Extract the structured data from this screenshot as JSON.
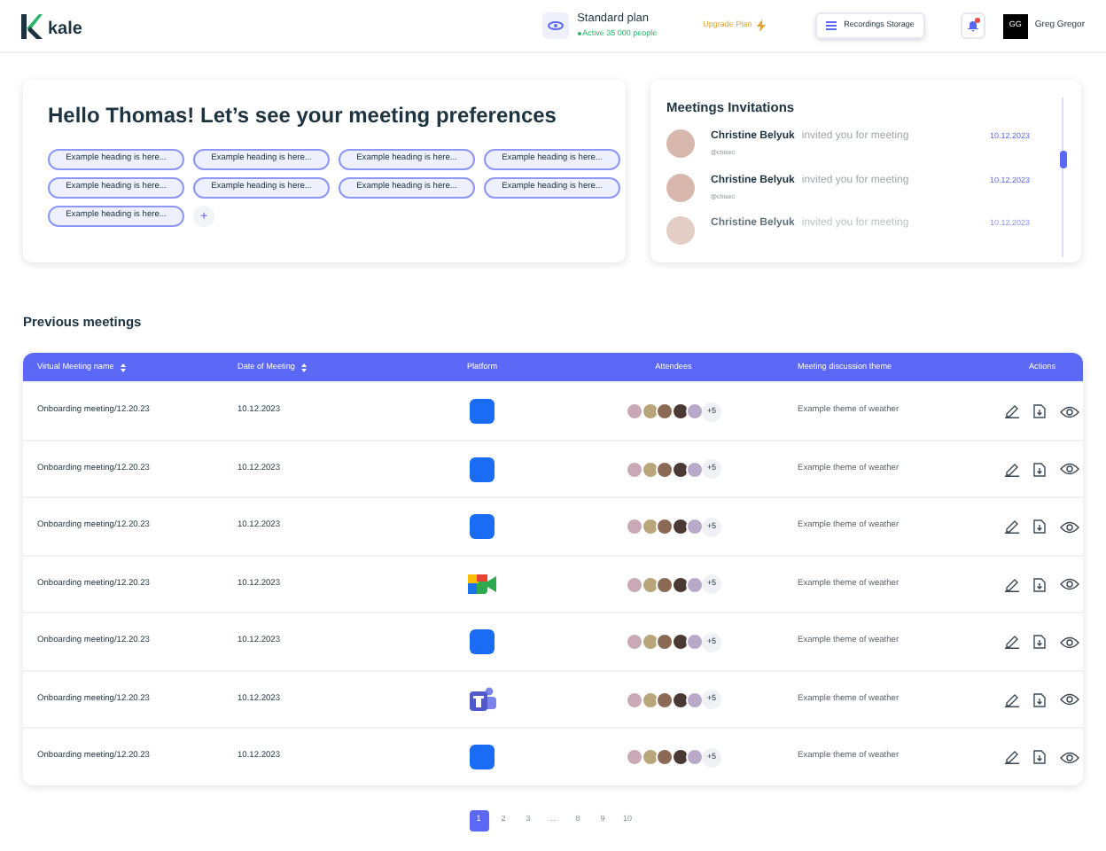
{
  "header": {
    "logo": "kale",
    "plan": {
      "name": "Standard plan",
      "status": "Active 35 000 people"
    },
    "upgrade": "Upgrade Plan",
    "storage": "Recordings Storage",
    "notifications": {
      "unread": true
    },
    "user": {
      "initials": "GG",
      "name": "Greg Gregor"
    }
  },
  "preferences": {
    "title": "Hello Thomas! Let’s see your meeting preferences",
    "tags": [
      "Example heading is here...",
      "Example heading is here...",
      "Example heading is here...",
      "Example heading is here...",
      "Example heading is here...",
      "Example heading is here...",
      "Example heading is here...",
      "Example heading is here...",
      "Example heading is here..."
    ],
    "add": "+"
  },
  "invitations": {
    "title": "Meetings Invitations",
    "items": [
      {
        "name": "Christine Belyuk",
        "message": "invited you for meeting",
        "handle": "@chisec",
        "date": "10.12.2023",
        "faded": false
      },
      {
        "name": "Christine Belyuk",
        "message": "invited you for meeting",
        "handle": "@chisec",
        "date": "10.12.2023",
        "faded": false
      },
      {
        "name": "Christine Belyuk",
        "message": "invited you for meeting",
        "date": "10.12.2023",
        "faded": true
      }
    ]
  },
  "previous": {
    "title": "Previous meetings",
    "columns": [
      {
        "label": "Virtual Meeting name",
        "sortable": true
      },
      {
        "label": "Date of Meeting",
        "sortable": true
      },
      {
        "label": "Platform",
        "sortable": false
      },
      {
        "label": "Attendees",
        "sortable": false
      },
      {
        "label": "Meeting discussion theme",
        "sortable": false
      },
      {
        "label": "Actions",
        "sortable": false
      }
    ],
    "rows": [
      {
        "name": "Onboarding meeting/12.20.23",
        "date": "10.12.2023",
        "kind": "zoom",
        "more": "+5",
        "theme": "Example theme of weather"
      },
      {
        "name": "Onboarding meeting/12.20.23",
        "date": "10.12.2023",
        "kind": "zoom",
        "more": "+5",
        "theme": "Example theme of weather"
      },
      {
        "name": "Onboarding meeting/12.20.23",
        "date": "10.12.2023",
        "kind": "zoom",
        "more": "+5",
        "theme": "Example theme of weather"
      },
      {
        "name": "Onboarding meeting/12.20.23",
        "date": "10.12.2023",
        "kind": "meet",
        "more": "+5",
        "theme": "Example theme of weather"
      },
      {
        "name": "Onboarding meeting/12.20.23",
        "date": "10.12.2023",
        "kind": "zoom",
        "more": "+5",
        "theme": "Example theme of weather"
      },
      {
        "name": "Onboarding meeting/12.20.23",
        "date": "10.12.2023",
        "kind": "teams",
        "more": "+5",
        "theme": "Example theme of weather"
      },
      {
        "name": "Onboarding meeting/12.20.23",
        "date": "10.12.2023",
        "kind": "zoom",
        "more": "+5",
        "theme": "Example theme of weather"
      }
    ]
  },
  "pagination": [
    {
      "label": "1",
      "selected": true
    },
    {
      "label": "2",
      "selected": false
    },
    {
      "label": "3",
      "selected": false
    },
    {
      "label": "...",
      "selected": false
    },
    {
      "label": "8",
      "selected": false
    },
    {
      "label": "9",
      "selected": false
    },
    {
      "label": "10",
      "selected": false
    }
  ]
}
